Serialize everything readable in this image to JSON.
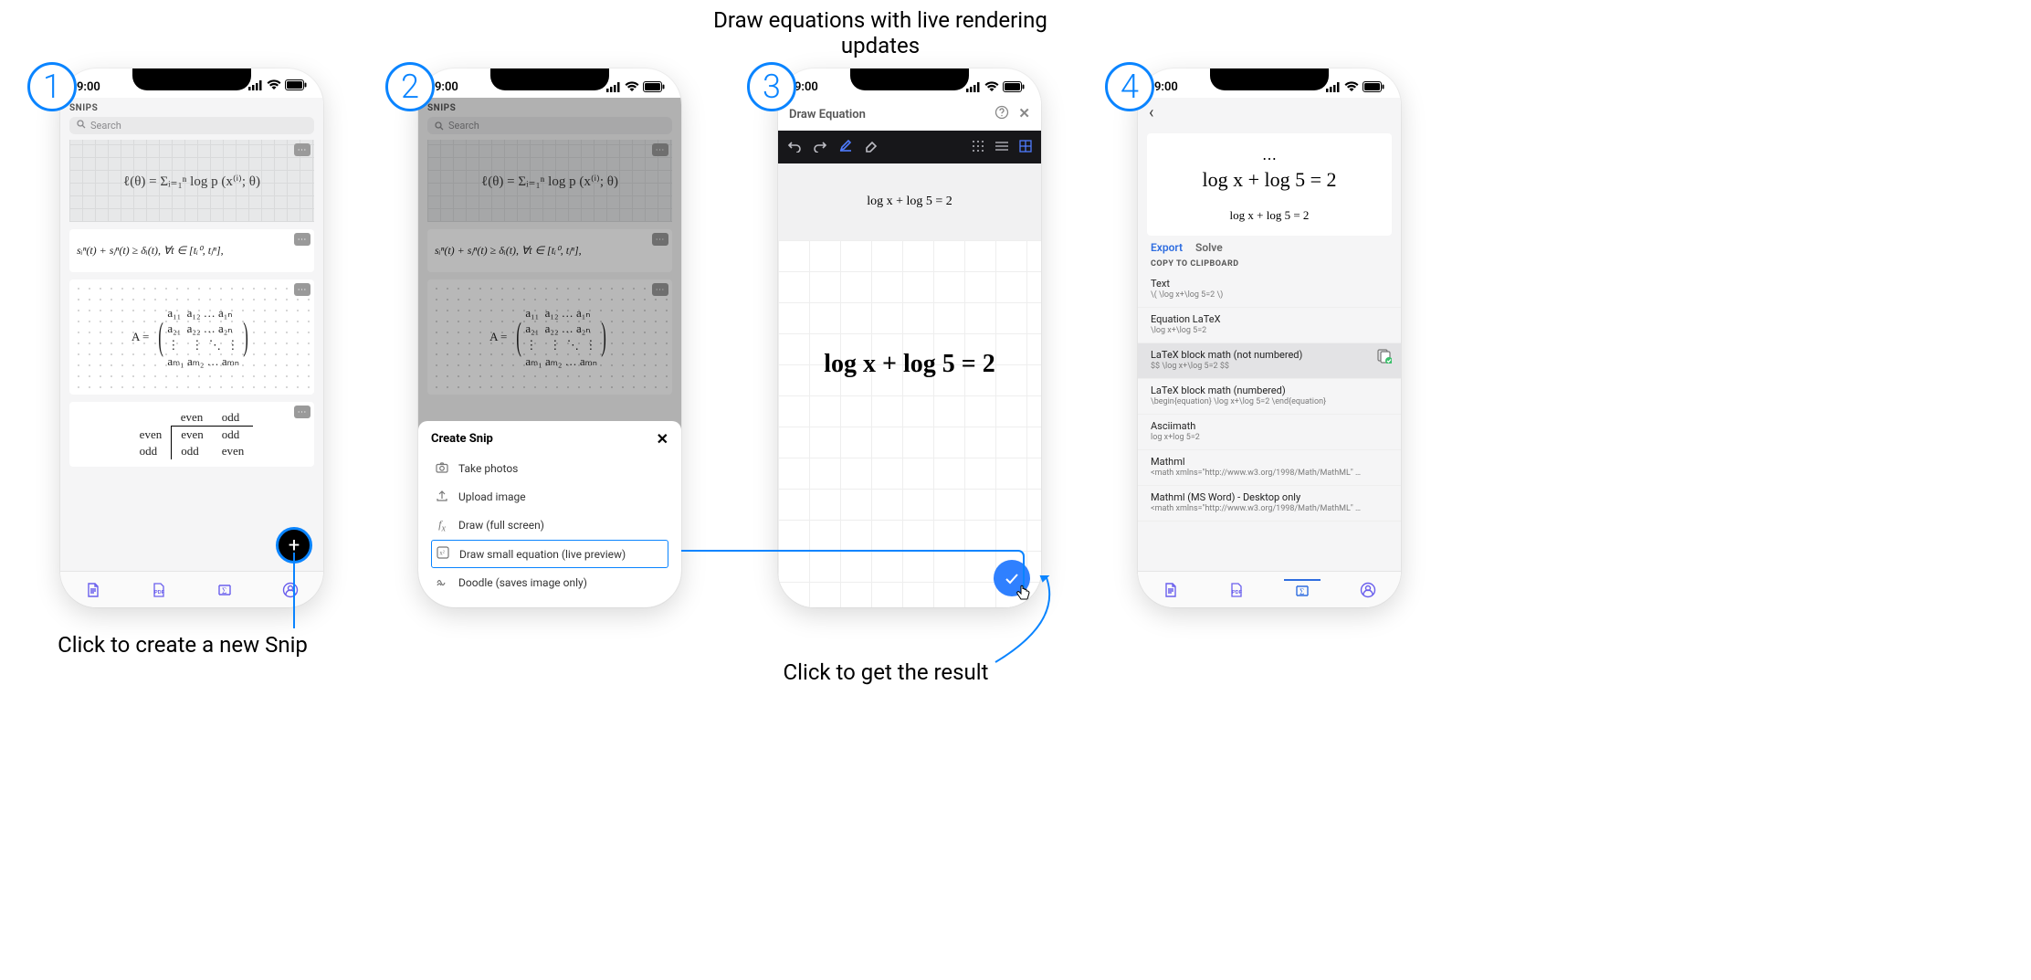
{
  "status": {
    "time": "9:00"
  },
  "captions": {
    "top": "Draw equations with live rendering updates",
    "step1": "Click to create a new Snip",
    "step3": "Click to get the result"
  },
  "steps": [
    "1",
    "2",
    "3",
    "4"
  ],
  "snips": {
    "header": "SNIPS",
    "search_placeholder": "Search",
    "card1_handwritten": "ℓ(θ) = Σᵢ₌₁ⁿ log p (x⁽ⁱ⁾; θ)",
    "card2_formula": "sᵢⁿ(t) + sⱼⁿ(t) ≥ δᵢ(t),   ∀t ∈ [tᵢ⁰, tⱼⁿ],",
    "card3_matrix_lhs": "A =",
    "card3_matrix_rows": [
      [
        "a₁₁",
        "a₁₂",
        "…",
        "a₁ₙ"
      ],
      [
        "a₂₁",
        "a₂₂",
        "…",
        "a₂ₙ"
      ],
      [
        "⋮",
        "⋮",
        "⋱",
        "⋮"
      ],
      [
        "aₘ₁",
        "aₘ₂",
        "…",
        "aₘₙ"
      ]
    ],
    "card4_table": {
      "cols": [
        "",
        "even",
        "odd"
      ],
      "rows": [
        [
          "even",
          "even",
          "odd"
        ],
        [
          "odd",
          "odd",
          "even"
        ]
      ]
    }
  },
  "sheet": {
    "title": "Create Snip",
    "items": [
      {
        "icon": "camera",
        "label": "Take photos"
      },
      {
        "icon": "upload",
        "label": "Upload image"
      },
      {
        "icon": "fx",
        "label": "Draw (full screen)"
      },
      {
        "icon": "eq",
        "label": "Draw small equation (live preview)",
        "highlight": true
      },
      {
        "icon": "scribble",
        "label": "Doodle (saves image only)"
      }
    ]
  },
  "draw": {
    "title": "Draw Equation",
    "preview": "log x + log 5 = 2",
    "handwriting": "log x + log 5 = 2"
  },
  "result": {
    "big": "log x + log 5 = 2",
    "small": "log x + log 5 = 2",
    "tabs": [
      "Export",
      "Solve"
    ],
    "section": "COPY TO CLIPBOARD",
    "items": [
      {
        "t": "Text",
        "s": "\\( \\log x+\\log 5=2 \\)"
      },
      {
        "t": "Equation LaTeX",
        "s": "\\log x+\\log 5=2"
      },
      {
        "t": "LaTeX block math (not numbered)",
        "s": "$$ \\log x+\\log 5=2 $$",
        "selected": true
      },
      {
        "t": "LaTeX block math (numbered)",
        "s": "\\begin{equation} \\log x+\\log 5=2 \\end{equation}"
      },
      {
        "t": "Asciimath",
        "s": "log x+log 5=2"
      },
      {
        "t": "Mathml",
        "s": "<math xmlns=\"http://www.w3.org/1998/Math/MathML\" display=\"block\"> <…"
      },
      {
        "t": "Mathml (MS Word) - Desktop only",
        "s": "<math xmlns=\"http://www.w3.org/1998/Math/MathML\" display=\"block\"> <…"
      }
    ]
  }
}
